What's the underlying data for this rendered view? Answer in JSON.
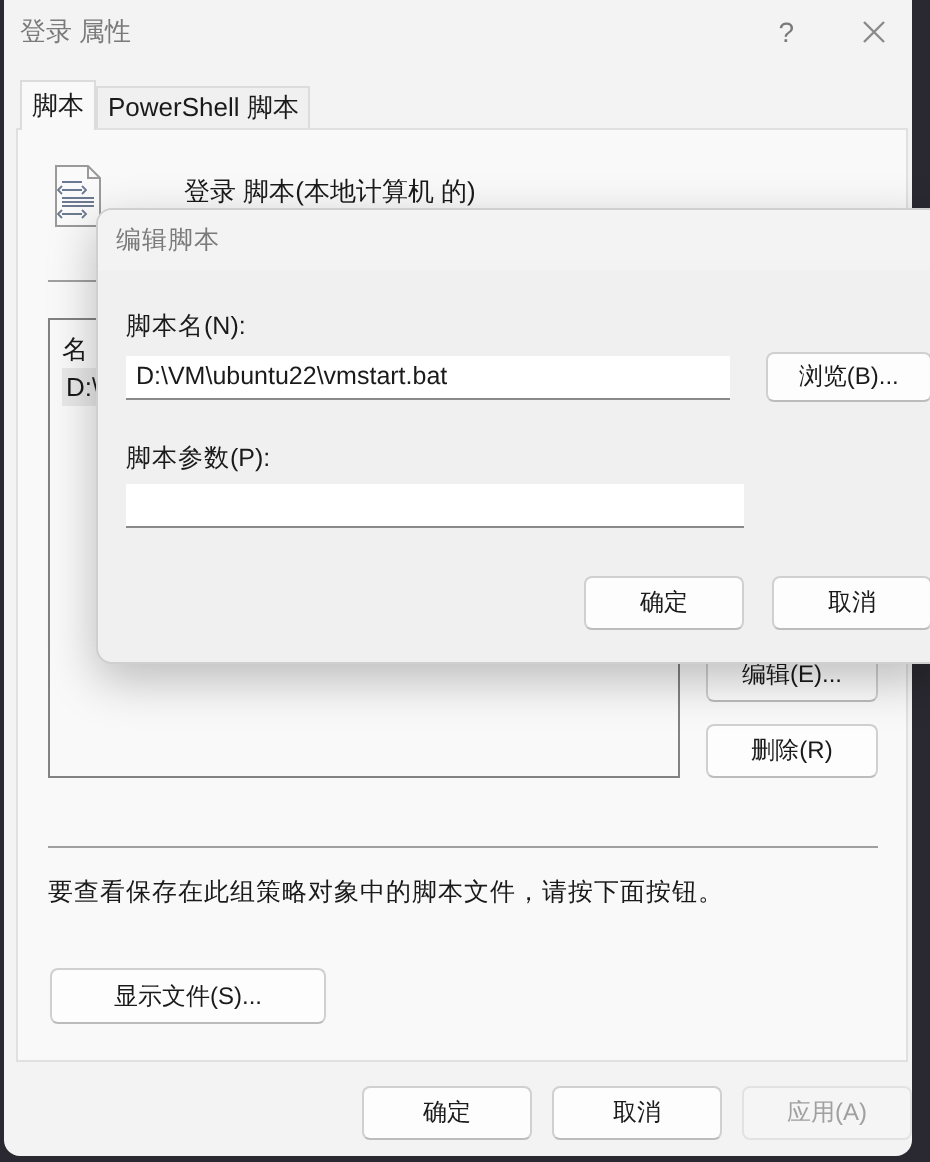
{
  "window": {
    "title": "登录 属性",
    "help": "?"
  },
  "tabs": [
    {
      "label": "脚本",
      "selected": true
    },
    {
      "label": "PowerShell 脚本",
      "selected": false
    }
  ],
  "header": "登录 脚本(本地计算机 的)",
  "script_list": {
    "column_header": "名",
    "rows": [
      "D:\\"
    ]
  },
  "side_buttons": [
    "编辑(E)...",
    "删除(R)"
  ],
  "hint": "要查看保存在此组策略对象中的脚本文件，请按下面按钮。",
  "show_files_button": "显示文件(S)...",
  "footer_buttons": [
    {
      "label": "确定",
      "disabled": false
    },
    {
      "label": "取消",
      "disabled": false
    },
    {
      "label": "应用(A)",
      "disabled": true
    }
  ],
  "edit_dialog": {
    "title": "编辑脚本",
    "fields": [
      {
        "label": "脚本名(N):",
        "value": "D:\\VM\\ubuntu22\\vmstart.bat"
      },
      {
        "label": "脚本参数(P):"
      }
    ],
    "browse_button": "浏览(B)...",
    "buttons": [
      "确定",
      "取消"
    ]
  }
}
